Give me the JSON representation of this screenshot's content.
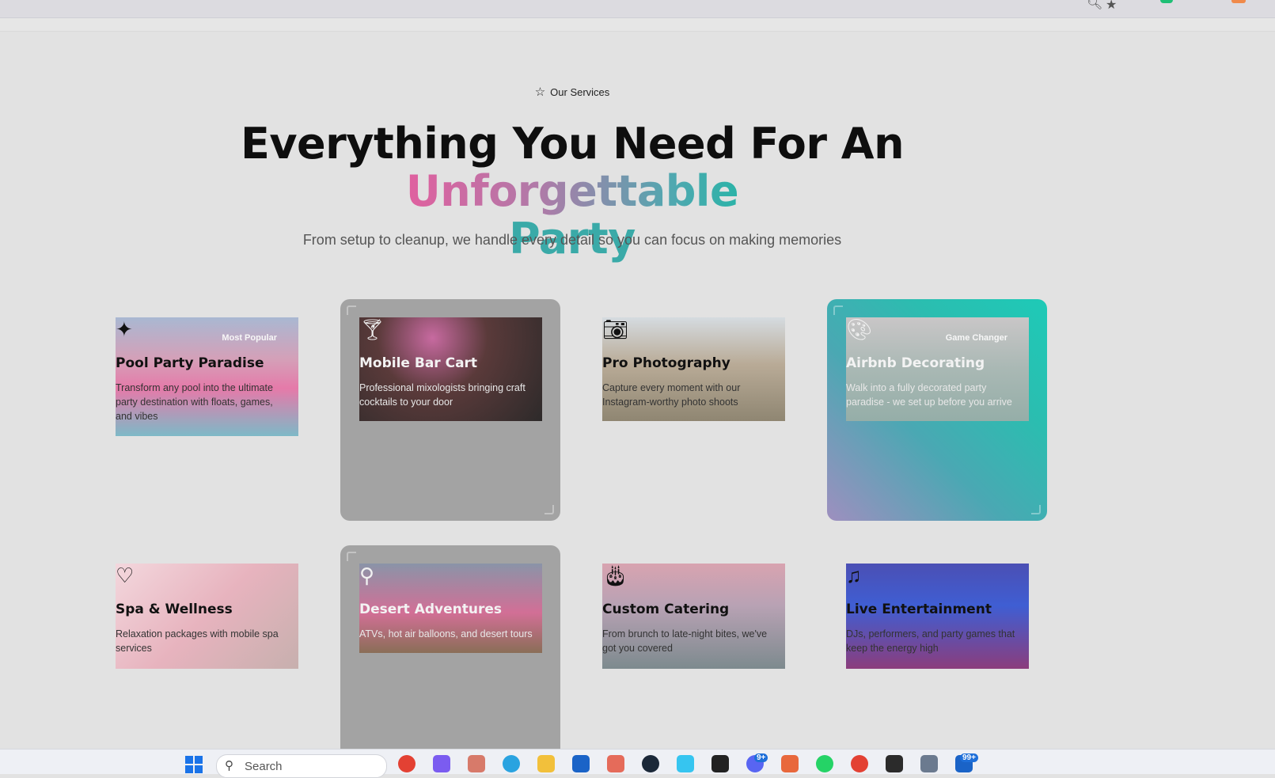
{
  "browser": {
    "icons": [
      "zoom-icon",
      "bookmark-star-icon",
      "extension-icon",
      "extension-icon"
    ]
  },
  "section": {
    "eyebrow": "Our Services",
    "headline_plain": "Everything You Need For An ",
    "headline_accent": "Unforgettable",
    "headline_accent2": "Party",
    "subtitle": "From setup to cleanup, we handle every detail so you can focus on making memories"
  },
  "services": [
    {
      "title": "Pool Party Paradise",
      "desc": "Transform any pool into the ultimate party destination with floats, games, and vibes",
      "badge": "Most Popular",
      "icon": "sparkles-icon"
    },
    {
      "title": "Mobile Bar Cart",
      "desc": "Professional mixologists bringing craft cocktails to your door",
      "icon": "cocktail-icon"
    },
    {
      "title": "Pro Photography",
      "desc": "Capture every moment with our Instagram-worthy photo shoots",
      "icon": "camera-icon"
    },
    {
      "title": "Airbnb Decorating",
      "desc": "Walk into a fully decorated party paradise - we set up before you arrive",
      "badge": "Game Changer",
      "icon": "palette-icon"
    },
    {
      "title": "Spa & Wellness",
      "desc": "Relaxation packages with mobile spa services",
      "icon": "heart-icon"
    },
    {
      "title": "Desert Adventures",
      "desc": "ATVs, hot air balloons, and desert tours",
      "icon": "map-pin-icon"
    },
    {
      "title": "Custom Catering",
      "desc": "From brunch to late-night bites, we've got you covered",
      "icon": "cake-icon"
    },
    {
      "title": "Live Entertainment",
      "desc": "DJs, performers, and party games that keep the energy high",
      "icon": "music-note-icon"
    }
  ],
  "taskbar": {
    "search_placeholder": "Search",
    "discord_badge": "9+",
    "mail_badge": "99+",
    "colors": {
      "chrome": "#e34133",
      "copilot": "#7b5cf0",
      "telegram": "#2aa3e0",
      "folder": "#f2c03b",
      "outlook": "#1a63c7",
      "steam": "#1b2838",
      "whatsapp": "#25d366",
      "terminal": "#2b2b2b"
    }
  }
}
